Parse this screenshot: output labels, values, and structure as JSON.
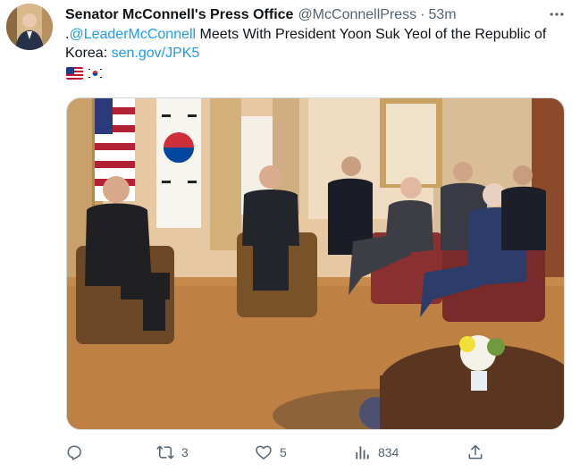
{
  "tweet": {
    "author": {
      "display_name": "Senator McConnell's Press Office",
      "handle": "@McConnellPress",
      "separator": "·",
      "time": "53m"
    },
    "text": {
      "prefix": ".",
      "mention": "@LeaderMcConnell",
      "body": " Meets With President Yoon Suk Yeol of the Republic of Korea: ",
      "url": "sen.gov/JPK5"
    },
    "flags": [
      "flag-us-icon",
      "flag-kr-icon"
    ],
    "media": {
      "kind": "photo"
    },
    "actions": {
      "reply": {
        "icon": "reply-icon",
        "count": ""
      },
      "retweet": {
        "icon": "retweet-icon",
        "count": "3"
      },
      "like": {
        "icon": "heart-icon",
        "count": "5"
      },
      "views": {
        "icon": "views-icon",
        "count": "834"
      },
      "share": {
        "icon": "share-icon",
        "count": ""
      }
    }
  },
  "colors": {
    "text_primary": "#0f1419",
    "text_secondary": "#536471",
    "link": "#1d9bf0",
    "border": "#cfd9de"
  }
}
